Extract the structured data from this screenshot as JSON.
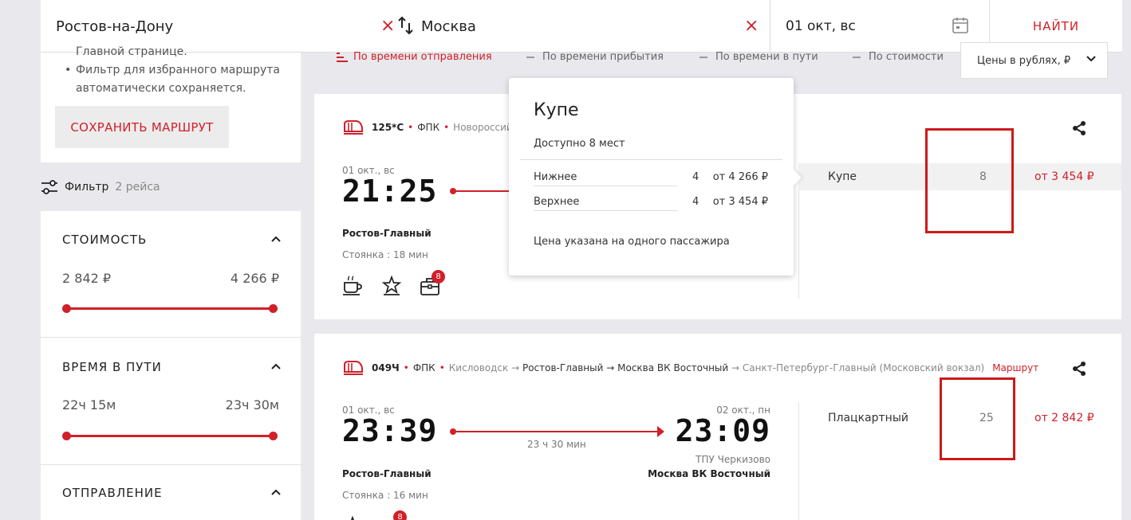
{
  "search": {
    "from": "Ростов-на-Дону",
    "to": "Москва",
    "date": "01 окт, вс",
    "find_label": "НАЙТИ"
  },
  "sidebar": {
    "note_partial": "Главной странице.",
    "note_item": "Фильтр для избранного маршрута автоматически сохраняется.",
    "save_route_label": "СОХРАНИТЬ МАРШРУТ",
    "filter_label": "Фильтр",
    "filter_count": "2 рейса",
    "cost": {
      "title": "СТОИМОСТЬ",
      "min": "2 842 ₽",
      "max": "4 266 ₽",
      "range_fraction": [
        0,
        1
      ]
    },
    "travel_time": {
      "title": "ВРЕМЯ В ПУТИ",
      "min": "22ч 15м",
      "max": "23ч 30м",
      "range_fraction": [
        0,
        1
      ]
    },
    "departure": {
      "title": "ОТПРАВЛЕНИЕ"
    }
  },
  "sort": {
    "items": [
      "По времени отправления",
      "По времени прибытия",
      "По времени в пути",
      "По стоимости"
    ],
    "active_index": 0,
    "currency": "Цены в рублях, ₽"
  },
  "trains": [
    {
      "number": "125*С",
      "carrier": "ФПК",
      "route": "Новороссий",
      "dep_date": "01 окт., вс",
      "dep_time": "21:25",
      "dep_station": "Ростов-Главный",
      "stop": "Стоянка : 18 мин",
      "amenities_badge": "8",
      "seats": [
        {
          "class": "Купе",
          "count": "8",
          "price": "от 3 454 ₽"
        }
      ]
    },
    {
      "number": "049Ч",
      "carrier": "ФПК",
      "route_from": "Кисловодск →",
      "route_a": "Ростов-Главный",
      "route_arrow": "→",
      "route_b": "Москва ВК Восточный",
      "route_to": "→ Санкт-Петербург-Главный (Московский вокзал)",
      "route_link": "Маршрут",
      "dep_date": "01 окт., вс",
      "dep_time": "23:39",
      "duration": "23 ч 30 мин",
      "arr_date": "02 окт., пн",
      "arr_time": "23:09",
      "dep_station": "Ростов-Главный",
      "arr_station_note": "ТПУ Черкизово",
      "arr_station": "Москва ВК Восточный",
      "stop": "Стоянка : 16 мин",
      "amenities_badge": "8",
      "seats": [
        {
          "class": "Плацкартный",
          "count": "25",
          "price": "от 2 842 ₽"
        }
      ]
    }
  ],
  "tooltip": {
    "title": "Купе",
    "available": "Доступно 8 мест",
    "rows": [
      {
        "name": "Нижнее",
        "qty": "4",
        "price": "от  4 266 ₽"
      },
      {
        "name": "Верхнее",
        "qty": "4",
        "price": "от  3 454 ₽"
      }
    ],
    "note": "Цена указана на одного пассажира"
  },
  "colors": {
    "accent": "#d0202a",
    "highlight_box": "#cc1a1a"
  }
}
